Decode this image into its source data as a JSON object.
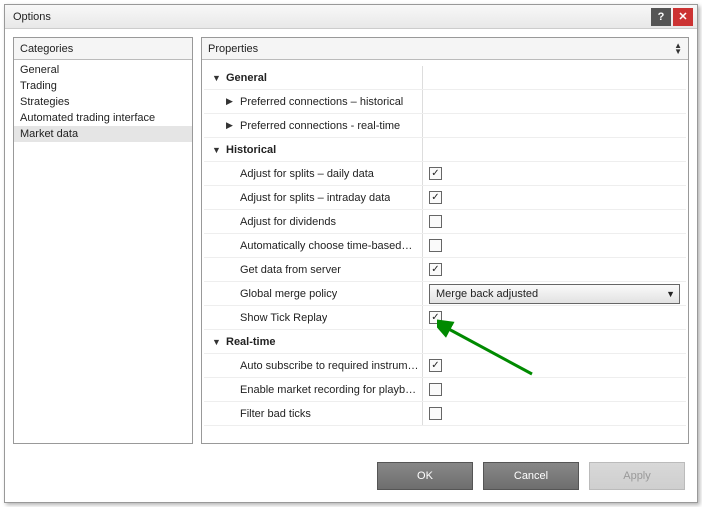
{
  "titlebar": {
    "title": "Options"
  },
  "categories": {
    "header": "Categories",
    "items": [
      {
        "label": "General"
      },
      {
        "label": "Trading"
      },
      {
        "label": "Strategies"
      },
      {
        "label": "Automated trading interface"
      },
      {
        "label": "Market data",
        "selected": true
      }
    ]
  },
  "properties": {
    "header": "Properties",
    "groups": [
      {
        "label": "General",
        "expanded": true,
        "rows": [
          {
            "type": "subgroup",
            "label": "Preferred connections – historical",
            "expanded": false
          },
          {
            "type": "subgroup",
            "label": "Preferred connections - real-time",
            "expanded": false
          }
        ]
      },
      {
        "label": "Historical",
        "expanded": true,
        "rows": [
          {
            "type": "check",
            "label": "Adjust for splits – daily data",
            "checked": true
          },
          {
            "type": "check",
            "label": "Adjust for splits – intraday data",
            "checked": true
          },
          {
            "type": "check",
            "label": "Adjust for dividends",
            "checked": false
          },
          {
            "type": "check",
            "label": "Automatically choose time-based…",
            "checked": false
          },
          {
            "type": "check",
            "label": "Get data from server",
            "checked": true
          },
          {
            "type": "select",
            "label": "Global merge policy",
            "value": "Merge back adjusted"
          },
          {
            "type": "check",
            "label": "Show Tick Replay",
            "checked": true,
            "highlight": true
          }
        ]
      },
      {
        "label": "Real-time",
        "expanded": true,
        "rows": [
          {
            "type": "check",
            "label": "Auto subscribe to required instrum…",
            "checked": true
          },
          {
            "type": "check",
            "label": "Enable market recording for playb…",
            "checked": false
          },
          {
            "type": "check",
            "label": "Filter bad ticks",
            "checked": false
          }
        ]
      }
    ]
  },
  "footer": {
    "ok": "OK",
    "cancel": "Cancel",
    "apply": "Apply"
  }
}
